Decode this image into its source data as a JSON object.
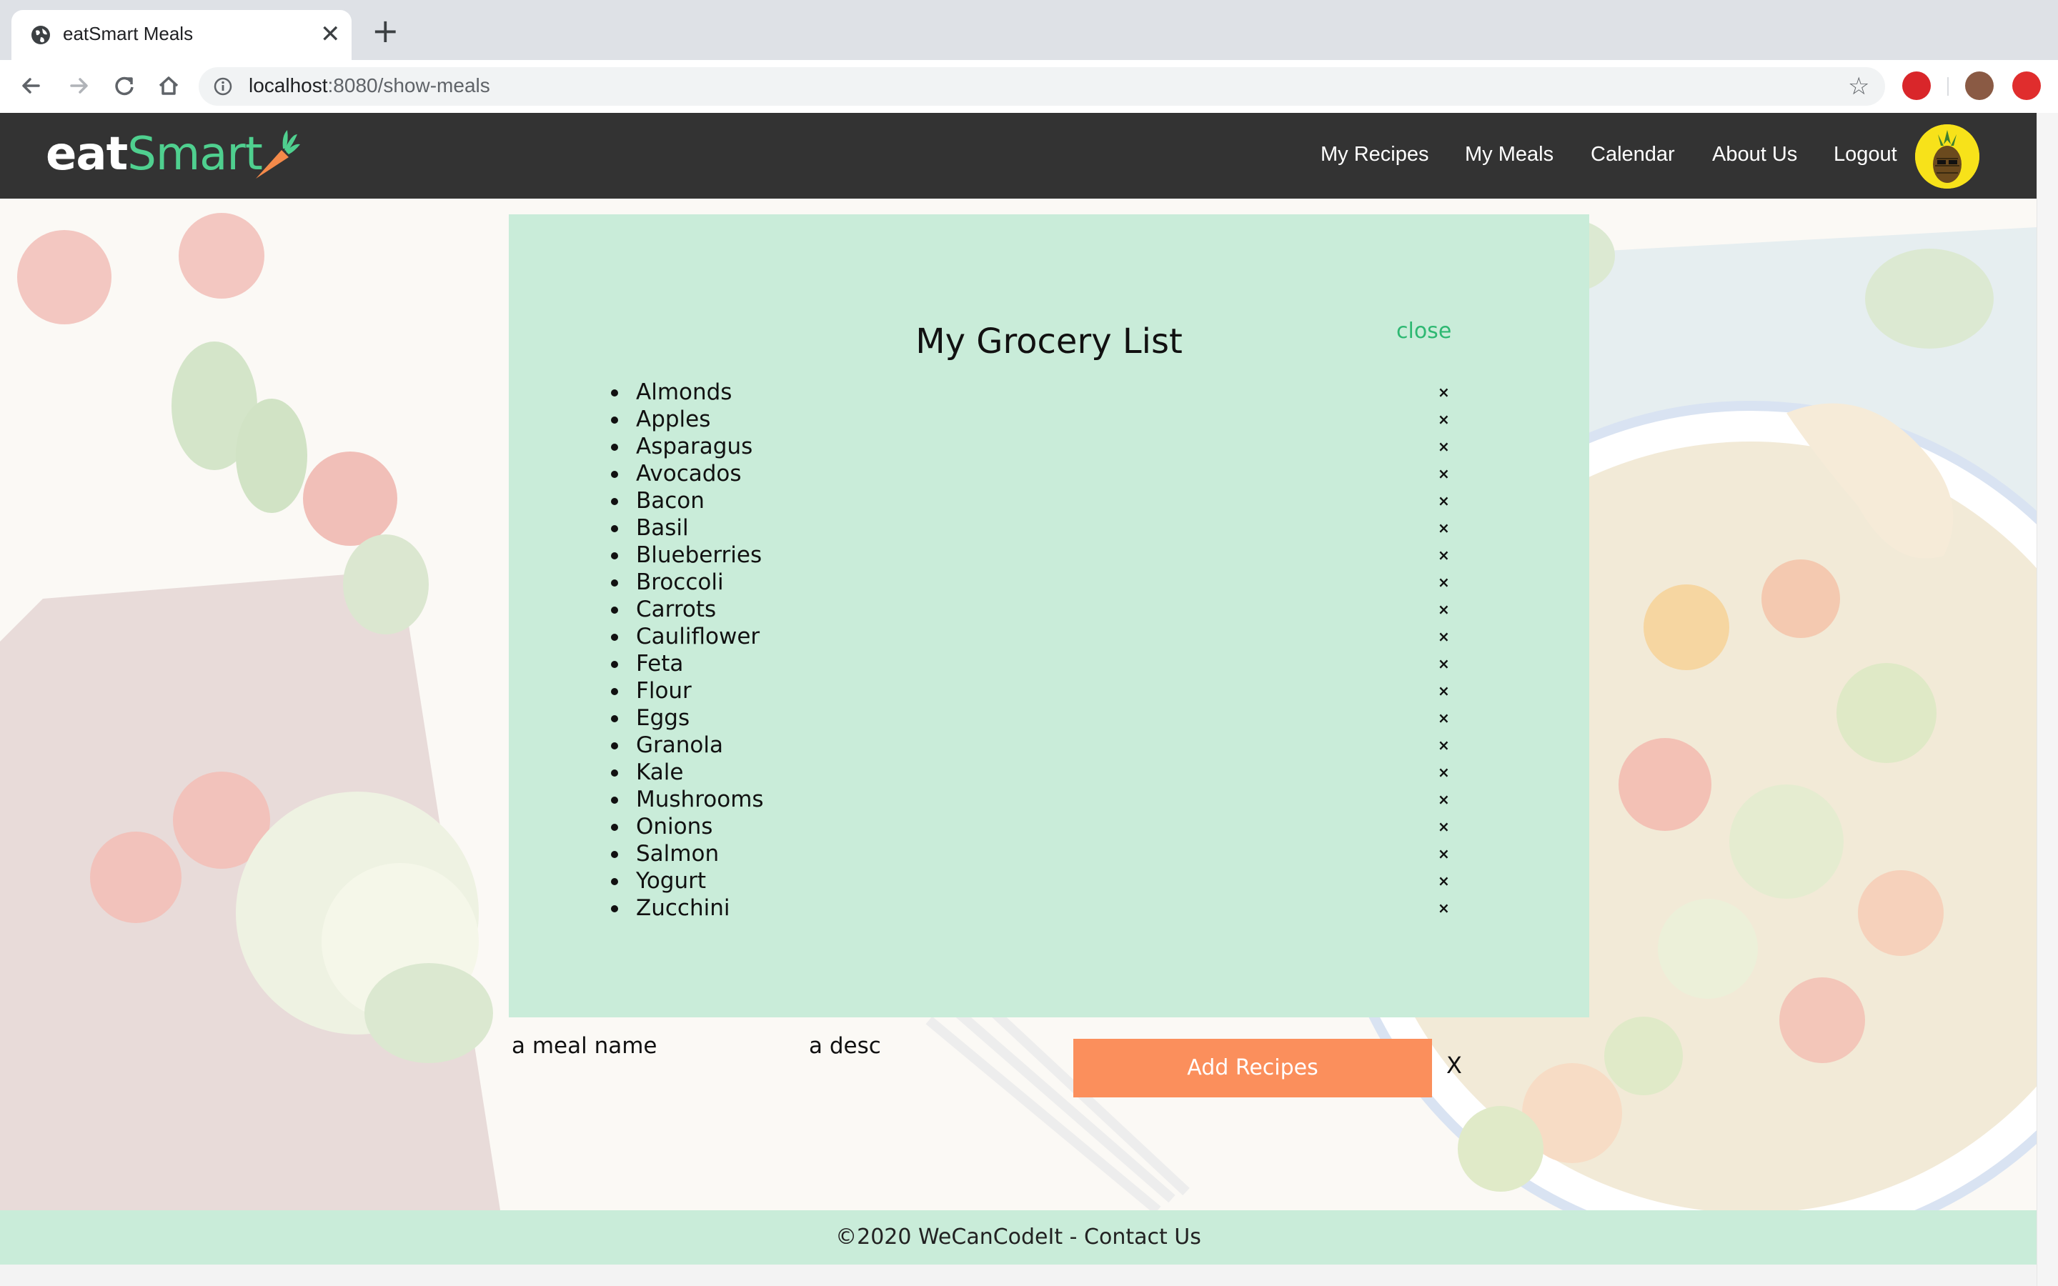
{
  "browser": {
    "tab_title": "eatSmart Meals",
    "tab_close": "✕",
    "new_tab": "+",
    "url_host": "localhost",
    "url_rest": ":8080/show-meals",
    "star": "☆"
  },
  "navbar": {
    "logo_eat": "eat",
    "logo_smart": "Smart",
    "links": [
      "My Recipes",
      "My Meals",
      "Calendar",
      "About Us",
      "Logout"
    ]
  },
  "modal": {
    "title": "My Grocery List",
    "close_label": "close",
    "remove_symbol": "×",
    "items": [
      "Almonds",
      "Apples",
      "Asparagus",
      "Avocados",
      "Bacon",
      "Basil",
      "Blueberries",
      "Broccoli",
      "Carrots",
      "Cauliflower",
      "Feta",
      "Flour",
      "Eggs",
      "Granola",
      "Kale",
      "Mushrooms",
      "Onions",
      "Salmon",
      "Yogurt",
      "Zucchini"
    ]
  },
  "form": {
    "meal_name_placeholder": "a meal name",
    "desc_placeholder": "a desc",
    "add_button": "Add Recipes",
    "x_label": "X"
  },
  "footer": {
    "text": "©2020 WeCanCodeIt - Contact Us"
  },
  "colors": {
    "navbar": "#333333",
    "brand_green": "#4fd08f",
    "modal_bg": "#c9ecd9",
    "button": "#fb8f5c"
  }
}
